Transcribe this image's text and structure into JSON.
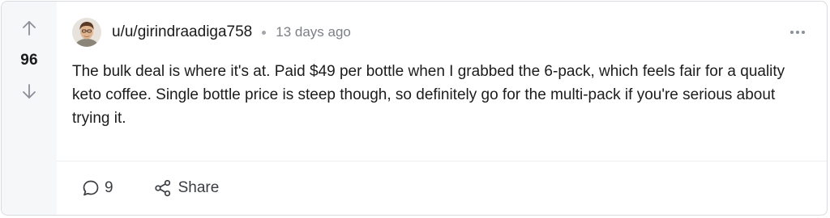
{
  "post": {
    "score": "96",
    "author": "u/u/girindraadiga758",
    "timestamp": "13 days ago",
    "body": "The bulk deal is where it's at. Paid $49 per bottle when I grabbed the 6-pack, which feels fair for a quality keto coffee. Single bottle price is steep though, so definitely go for the multi-pack if you're serious about trying it."
  },
  "actions": {
    "comments_count": "9",
    "share_label": "Share"
  },
  "icons": {
    "upvote": "arrow-up-icon",
    "downvote": "arrow-down-icon",
    "more": "more-horizontal-icon",
    "comment": "comment-bubble-icon",
    "share": "share-icon"
  },
  "colors": {
    "vote_column_bg": "#f6f7f8",
    "text": "#1c1c1d",
    "muted": "#7c7f86",
    "border": "#d9dbe0"
  }
}
